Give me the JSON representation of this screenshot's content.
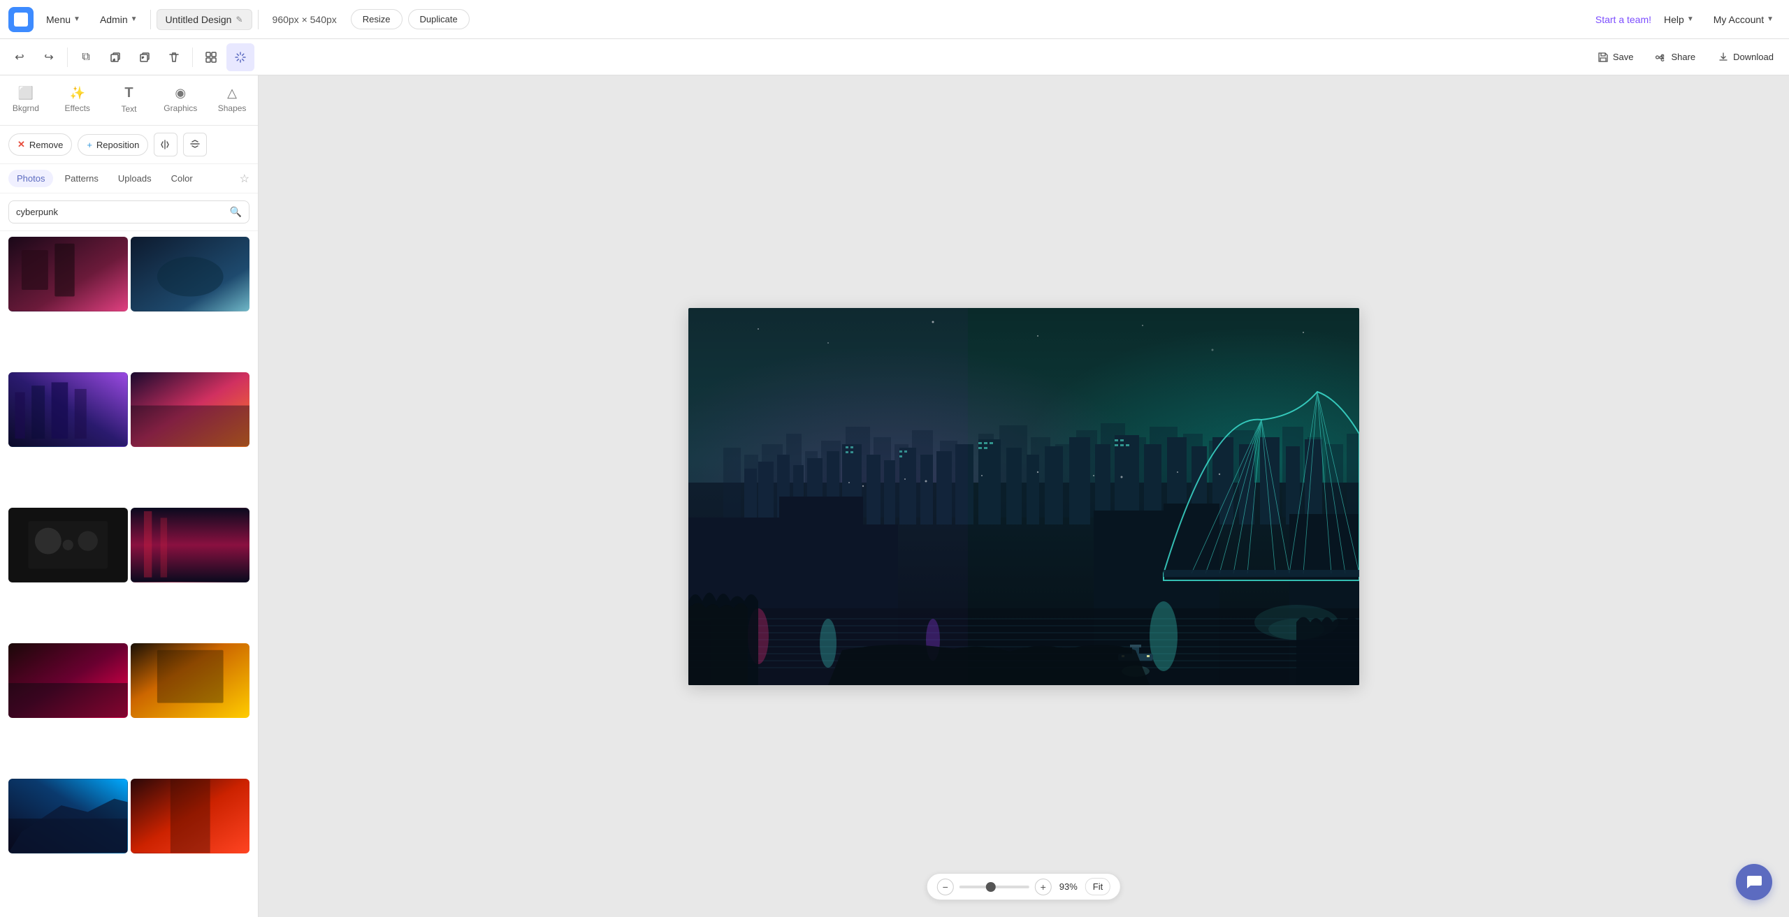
{
  "topNav": {
    "logoAlt": "Canva logo",
    "menuLabel": "Menu",
    "adminLabel": "Admin",
    "designTitle": "Untitled Design",
    "editIcon": "✎",
    "canvasSize": "960px × 540px",
    "resizeLabel": "Resize",
    "duplicateLabel": "Duplicate",
    "startTeamLabel": "Start a team!",
    "helpLabel": "Help",
    "myAccountLabel": "My Account"
  },
  "secondaryToolbar": {
    "undoLabel": "↩",
    "redoLabel": "↪",
    "copyLabel": "⧉",
    "layerDownLabel": "⬇",
    "layerUpLabel": "⬆",
    "deleteLabel": "🗑",
    "gridLabel": "⊞",
    "magicLabel": "✦",
    "saveLabel": "Save",
    "shareLabel": "Share",
    "downloadLabel": "Download"
  },
  "leftSidebar": {
    "tabs": [
      {
        "id": "bkgrnd",
        "label": "Bkgrnd",
        "icon": "⬜"
      },
      {
        "id": "effects",
        "label": "Effects",
        "icon": "✨"
      },
      {
        "id": "text",
        "label": "Text",
        "icon": "T"
      },
      {
        "id": "graphics",
        "label": "Graphics",
        "icon": "◉"
      },
      {
        "id": "shapes",
        "label": "Shapes",
        "icon": "△"
      }
    ],
    "removeLabel": "Remove",
    "repositionLabel": "Reposition",
    "removeIcon": "✕",
    "repositionIcon": "+",
    "flipHIcon": "⇔",
    "flipVIcon": "⇕",
    "photoTabs": [
      "Photos",
      "Patterns",
      "Uploads",
      "Color"
    ],
    "activePhotoTab": "Photos",
    "starIcon": "☆",
    "searchPlaceholder": "cyberpunk",
    "searchValue": "cyberpunk"
  },
  "zoomBar": {
    "minusIcon": "−",
    "plusIcon": "+",
    "zoomValue": "93%",
    "fitLabel": "Fit",
    "sliderValue": 93
  },
  "chatBubble": {
    "icon": "💬"
  }
}
